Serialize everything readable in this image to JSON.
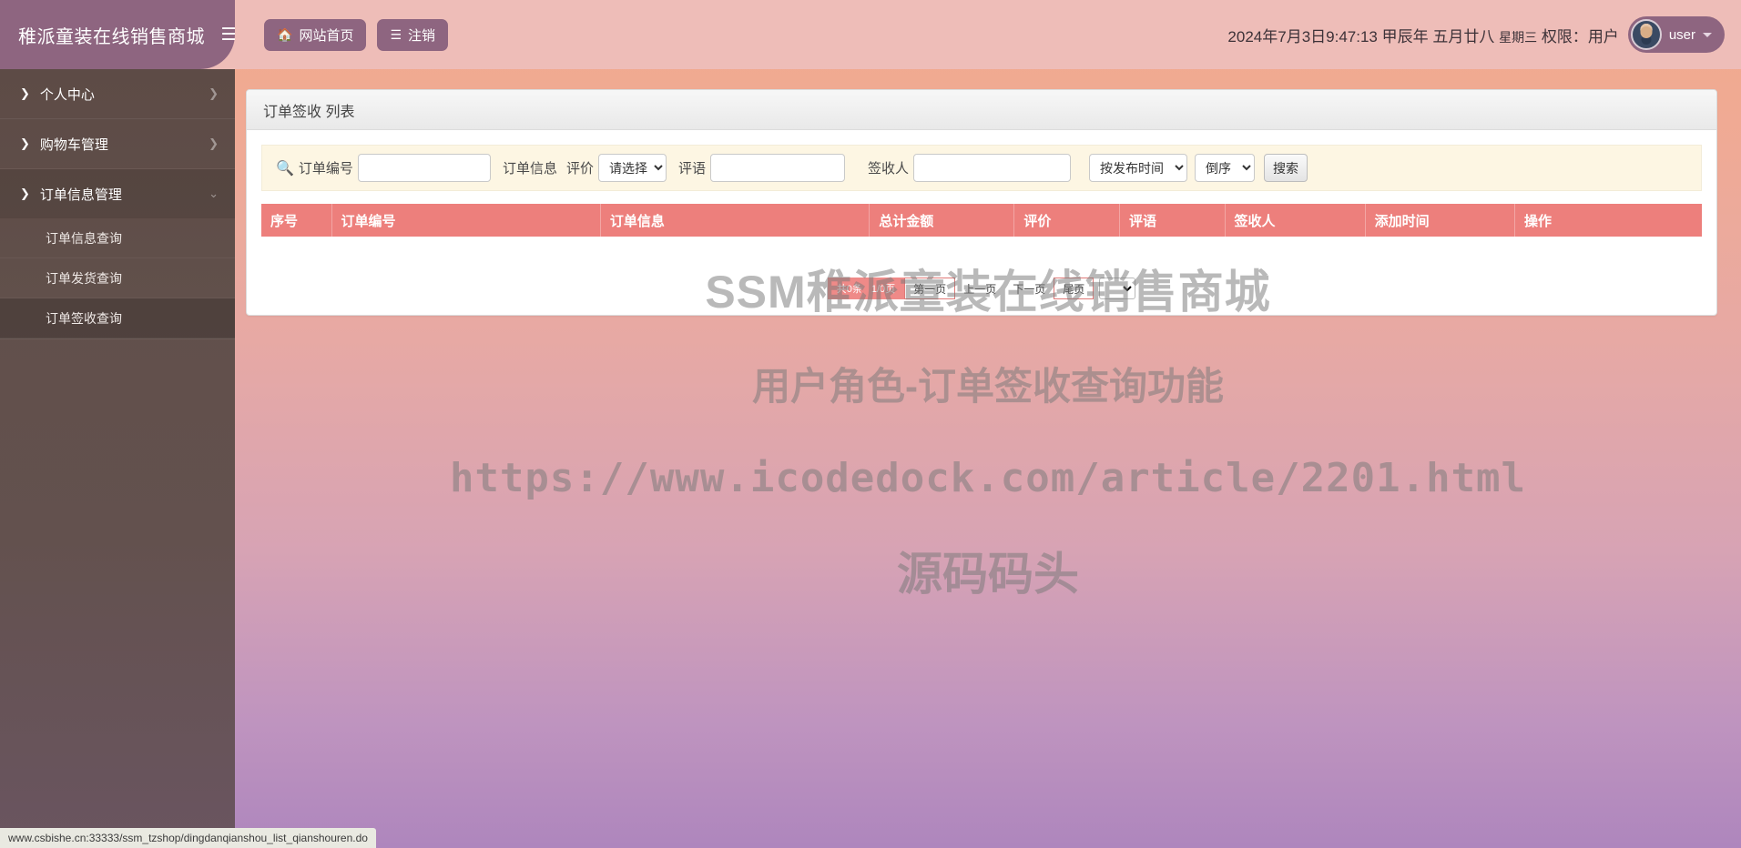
{
  "header": {
    "brand_title": "稚派童装在线销售商城",
    "menu_toggle_icon": "hamburger-icon",
    "nav_buttons": [
      {
        "icon": "home-icon",
        "glyph": "⌂",
        "label": "网站首页"
      },
      {
        "icon": "list-icon",
        "glyph": "☰",
        "label": "注销"
      }
    ],
    "datetime": "2024年7月3日9:47:13",
    "lunar_year": "甲辰年",
    "lunar_date": "五月廿八",
    "weekday": "星期三",
    "role_label": "权限：",
    "role_value": "用户",
    "user_name": "user",
    "caret_icon": "chevron-down-icon"
  },
  "sidebar": {
    "groups": [
      {
        "label": "个人中心",
        "lead_icon": "chevron-right-icon",
        "tail_icon": "chevron-right-icon",
        "open": false,
        "items": []
      },
      {
        "label": "购物车管理",
        "lead_icon": "chevron-right-icon",
        "tail_icon": "chevron-right-icon",
        "open": false,
        "items": []
      },
      {
        "label": "订单信息管理",
        "lead_icon": "chevron-right-icon",
        "tail_icon": "chevron-down-icon",
        "open": true,
        "items": [
          {
            "label": "订单信息查询",
            "active": false
          },
          {
            "label": "订单发货查询",
            "active": false
          },
          {
            "label": "订单签收查询",
            "active": true
          }
        ]
      }
    ]
  },
  "main": {
    "panel_title": "订单签收 列表",
    "filters": {
      "search_icon": "search-icon",
      "order_no_label": "订单编号",
      "order_no_value": "",
      "order_info_label": "订单信息",
      "rating_label": "评价",
      "rating_selected": "请选择",
      "rating_options": [
        "请选择"
      ],
      "comment_label": "评语",
      "comment_value": "",
      "receiver_label": "签收人",
      "receiver_value": "",
      "sort_field_selected": "按发布时间",
      "sort_field_options": [
        "按发布时间"
      ],
      "sort_dir_selected": "倒序",
      "sort_dir_options": [
        "倒序"
      ],
      "search_button_label": "搜索"
    },
    "table": {
      "columns": [
        "序号",
        "订单编号",
        "订单信息",
        "总计金额",
        "评价",
        "评语",
        "签收人",
        "添加时间",
        "操作"
      ],
      "rows": []
    },
    "pagination": {
      "total_text": "共0条",
      "page_text": "1/0页",
      "first_page": "第一页",
      "prev_page": "上一页",
      "next_page": "下一页",
      "last_page": "尾页",
      "page_size_selected": ""
    }
  },
  "watermark": {
    "line1": "SSM稚派童装在线销售商城",
    "line2": "用户角色-订单签收查询功能",
    "line3": "https://www.icodedock.com/article/2201.html",
    "line4": "源码码头"
  },
  "statusbar": {
    "url": "www.csbishe.cn:33333/ssm_tzshop/dingdanqianshou_list_qianshouren.do"
  },
  "colors": {
    "brand_purple": "#8e6580",
    "topbar_pink": "#eebdb8",
    "sidebar_brown": "#5d4b46",
    "table_header_red": "#ed7f7c",
    "filter_cream": "#fdf6e3"
  }
}
